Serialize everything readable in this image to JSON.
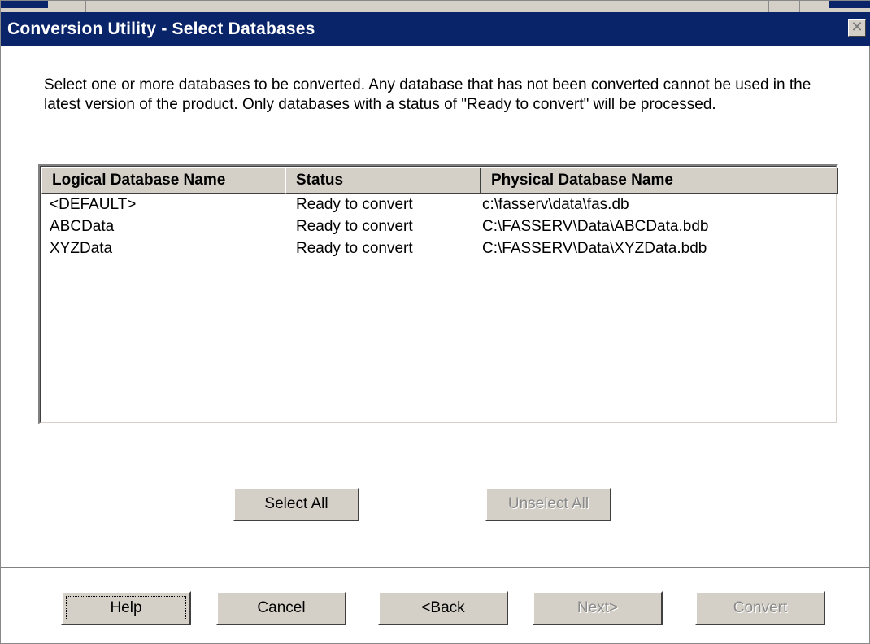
{
  "window": {
    "title": "Conversion Utility - Select Databases",
    "close_icon": "close-icon"
  },
  "description": "Select one or more databases to be converted. Any database that has not been converted cannot be used in the latest version of the product. Only databases with a status of \"Ready to convert\" will be processed.",
  "table": {
    "columns": [
      "Logical Database Name",
      "Status",
      "Physical Database Name"
    ],
    "rows": [
      [
        "<DEFAULT>",
        "Ready to convert",
        "c:\\fasserv\\data\\fas.db"
      ],
      [
        "ABCData",
        "Ready to convert",
        "C:\\FASSERV\\Data\\ABCData.bdb"
      ],
      [
        "XYZData",
        "Ready to convert",
        "C:\\FASSERV\\Data\\XYZData.bdb"
      ]
    ]
  },
  "selection_buttons": {
    "select_all": "Select All",
    "unselect_all": "Unselect All"
  },
  "footer_buttons": {
    "help": "Help",
    "cancel": "Cancel",
    "back": "<Back",
    "next": "Next>",
    "convert": "Convert"
  },
  "colors": {
    "titlebar": "#0a246a",
    "face": "#d4d0c8",
    "disabled_text": "#8a8a8a"
  }
}
